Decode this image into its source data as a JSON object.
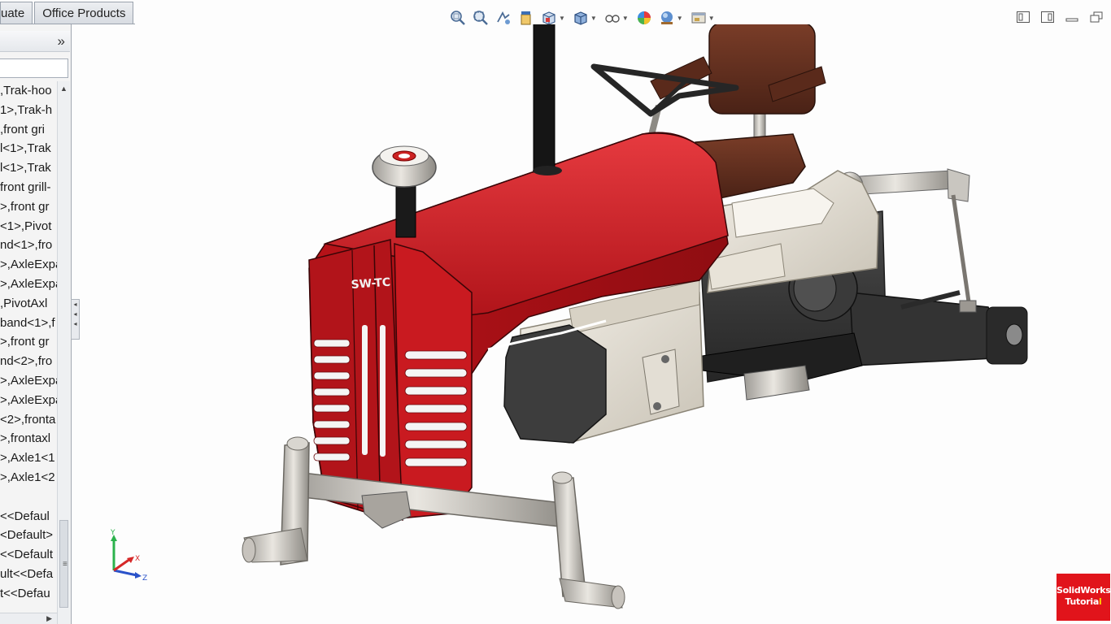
{
  "tabs": [
    {
      "label": "uate"
    },
    {
      "label": "Office Products"
    }
  ],
  "feature_tree": {
    "collapse_icon": "double-chevron-right-icon",
    "rows": [
      ",Trak-hoo",
      "1>,Trak-h",
      ",front gri",
      "l<1>,Trak",
      "l<1>,Trak",
      "front grill-",
      ">,front gr",
      "<1>,Pivot",
      "nd<1>,fro",
      ">,AxleExpa",
      ">,AxleExpa",
      ",PivotAxl",
      "band<1>,f",
      ">,front gr",
      "nd<2>,fro",
      ">,AxleExpa",
      ">,AxleExpa",
      "<2>,fronta",
      ">,frontaxl",
      ">,Axle1<1",
      ">,Axle1<2",
      "",
      "<<Defaul",
      "<Default>",
      "<<Default",
      "ult<<Defa",
      "t<<Defau"
    ]
  },
  "hud_toolbar": [
    {
      "name": "zoom-to-fit-icon"
    },
    {
      "name": "zoom-to-area-icon"
    },
    {
      "name": "previous-view-icon"
    },
    {
      "name": "section-view-icon"
    },
    {
      "name": "view-orientation-icon"
    },
    {
      "name": "display-style-icon"
    },
    {
      "name": "hide-show-items-icon"
    },
    {
      "name": "edit-appearance-icon"
    },
    {
      "name": "apply-scene-icon"
    },
    {
      "name": "view-settings-icon"
    }
  ],
  "triad": {
    "x": "X",
    "y": "Y",
    "z": "Z"
  },
  "badge": {
    "line1": "SolidWorks",
    "line2_main": "Tutoria",
    "line2_accent": "l"
  },
  "model": {
    "hood_text": "SW-TC",
    "hood_color": "#c4161c",
    "seat_color": "#6b3322",
    "frame_color": "#e6e1d6",
    "dark_color": "#3a3a3a"
  }
}
